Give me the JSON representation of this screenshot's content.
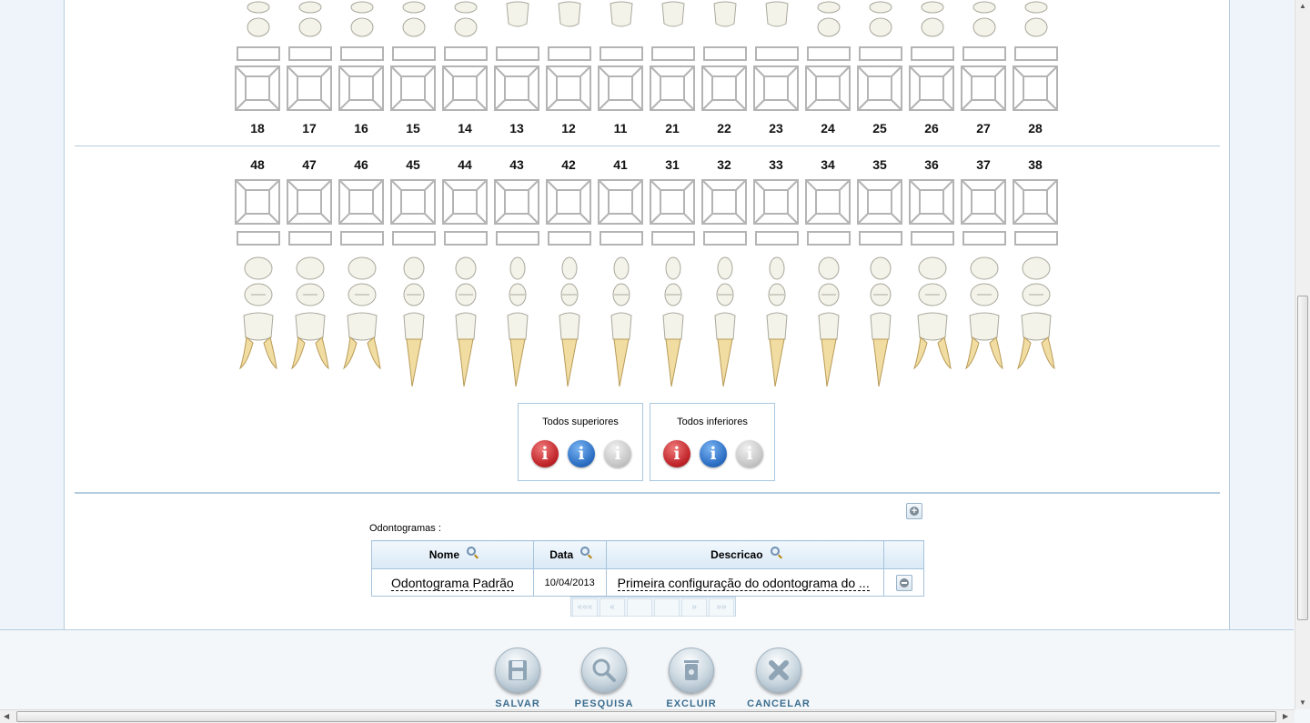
{
  "upper_teeth": [
    "18",
    "17",
    "16",
    "15",
    "14",
    "13",
    "12",
    "11",
    "21",
    "22",
    "23",
    "24",
    "25",
    "26",
    "27",
    "28"
  ],
  "lower_teeth": [
    "48",
    "47",
    "46",
    "45",
    "44",
    "43",
    "42",
    "41",
    "31",
    "32",
    "33",
    "34",
    "35",
    "36",
    "37",
    "38"
  ],
  "todos_superiores": {
    "label": "Todos superiores"
  },
  "todos_inferiores": {
    "label": "Todos inferiores"
  },
  "info_glyph": "i",
  "odontogramas_label": "Odontogramas :",
  "table": {
    "headers": {
      "nome": "Nome",
      "data": "Data",
      "descricao": "Descricao"
    },
    "rows": [
      {
        "nome": "Odontograma Padrão",
        "data": "10/04/2013",
        "descricao": "Primeira configuração do odontograma do ..."
      }
    ]
  },
  "pager": {
    "first": "«««",
    "prev": "«",
    "next": "»",
    "last": "»»"
  },
  "actions": {
    "salvar": "SALVAR",
    "pesquisa": "PESQUISA",
    "excluir": "EXCLUIR",
    "cancelar": "CANCELAR"
  },
  "colors": {
    "accent": "#3a6d8f",
    "border": "#b6cde0",
    "red": "#c0252a",
    "blue": "#2d6fc4",
    "gray": "#c6c6c6"
  }
}
